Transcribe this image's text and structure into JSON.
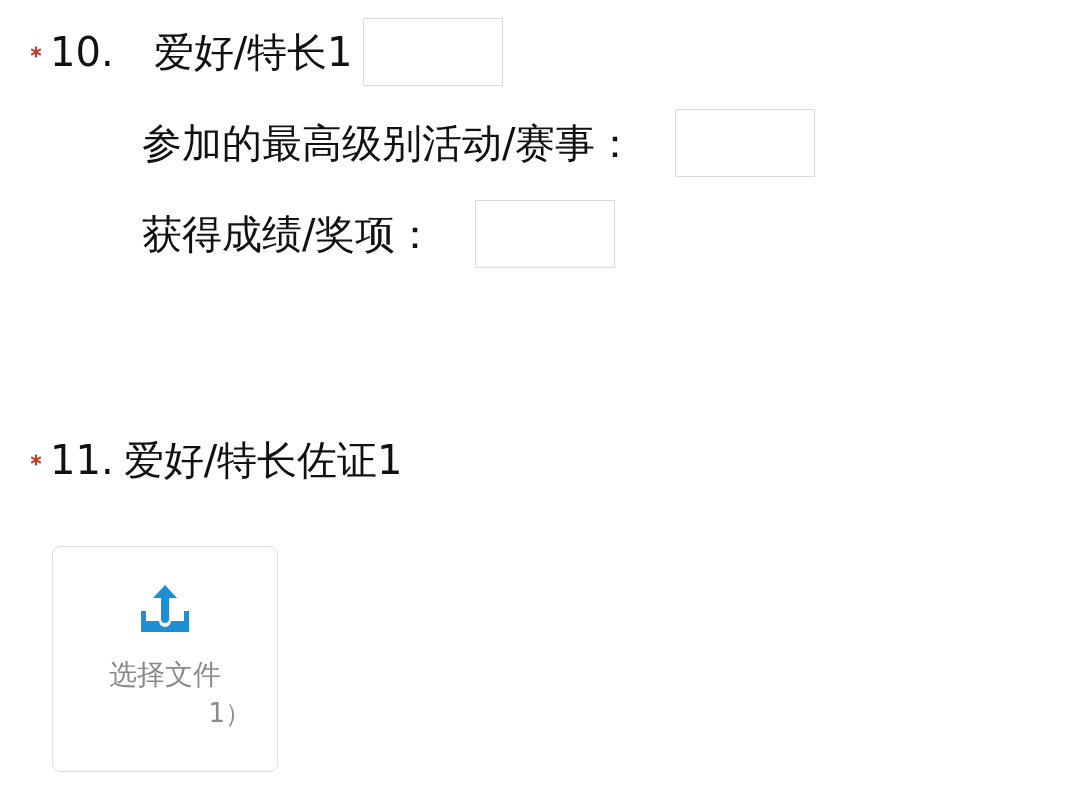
{
  "questions": [
    {
      "kind": "fill_in",
      "required": true,
      "number": "10.",
      "title": "爱好/特长1",
      "fields": [
        {
          "label": "参加的最高级别活动/赛事："
        },
        {
          "label": "获得成绩/奖项："
        }
      ]
    },
    {
      "kind": "upload",
      "required": true,
      "number": "11.",
      "title": "爱好/特长佐证1",
      "upload": {
        "label": "选择文件",
        "note": "1）"
      }
    }
  ]
}
